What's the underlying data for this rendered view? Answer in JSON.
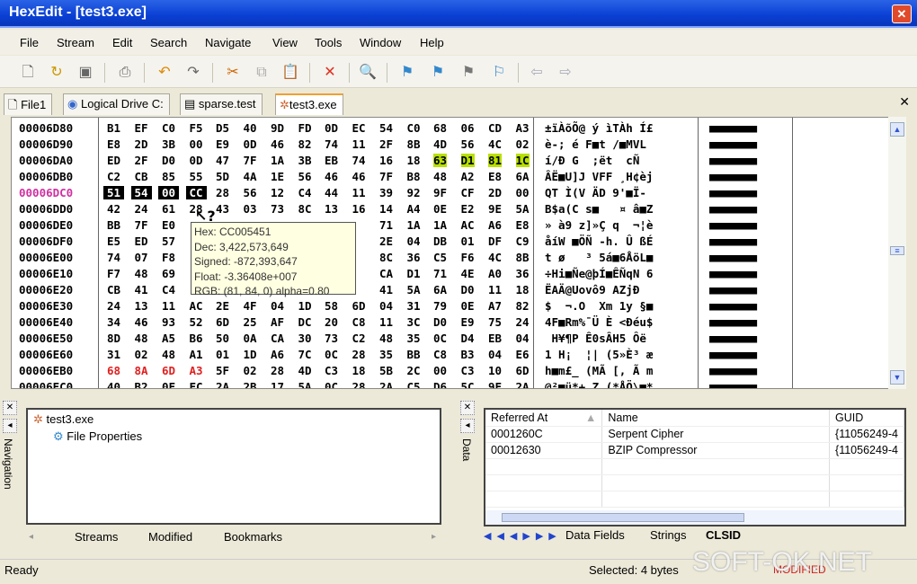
{
  "window": {
    "title": "HexEdit - [test3.exe]",
    "close": "✕"
  },
  "menu": [
    "File",
    "Stream",
    "Edit",
    "Search",
    "Navigate",
    "View",
    "Tools",
    "Window",
    "Help"
  ],
  "toolbar": [
    "new-file",
    "open",
    "save",
    "print",
    "undo",
    "redo",
    "cut",
    "copy",
    "paste",
    "delete",
    "find",
    "bookmark-set",
    "bookmark-next",
    "bookmark-toggle",
    "bookmark-clear",
    "back",
    "forward"
  ],
  "tabs": [
    "File1",
    "Logical Drive C:",
    "sparse.test",
    "test3.exe"
  ],
  "hex": {
    "rows": [
      {
        "addr": "00006D80",
        "bytes": [
          "B1",
          "EF",
          "C0",
          "F5",
          "D5",
          "40",
          "9D",
          "FD",
          "0D",
          "EC",
          "54",
          "C0",
          "68",
          "06",
          "CD",
          "A3"
        ],
        "ascii": "±ïÀõÕ@ ý ìTÀh Í£"
      },
      {
        "addr": "00006D90",
        "bytes": [
          "E8",
          "2D",
          "3B",
          "00",
          "E9",
          "0D",
          "46",
          "82",
          "74",
          "11",
          "2F",
          "8B",
          "4D",
          "56",
          "4C",
          "02"
        ],
        "ascii": "è-; é F■t /■MVL "
      },
      {
        "addr": "00006DA0",
        "bytes": [
          "ED",
          "2F",
          "D0",
          "0D",
          "47",
          "7F",
          "1A",
          "3B",
          "EB",
          "74",
          "16",
          "18",
          "63",
          "D1",
          "81",
          "1C"
        ],
        "ascii": "í/Ð G  ;ët  cÑ  "
      },
      {
        "addr": "00006DB0",
        "bytes": [
          "C2",
          "CB",
          "85",
          "55",
          "5D",
          "4A",
          "1E",
          "56",
          "46",
          "46",
          "7F",
          "B8",
          "48",
          "A2",
          "E8",
          "6A"
        ],
        "ascii": "ÂË■U]J VFF ¸H¢èj"
      },
      {
        "addr": "00006DC0",
        "bytes": [
          "51",
          "54",
          "00",
          "CC",
          "28",
          "56",
          "12",
          "C4",
          "44",
          "11",
          "39",
          "92",
          "9F",
          "CF",
          "2D",
          "00"
        ],
        "ascii": "QT Ì(V ÄD 9'■Ï- "
      },
      {
        "addr": "00006DD0",
        "bytes": [
          "42",
          "24",
          "61",
          "28",
          "43",
          "03",
          "73",
          "8C",
          "13",
          "16",
          "14",
          "A4",
          "0E",
          "E2",
          "9E",
          "5A"
        ],
        "ascii": "B$a(C s■   ¤ â■Z"
      },
      {
        "addr": "00006DE0",
        "bytes": [
          "BB",
          "7F",
          "E0",
          "",
          "",
          "",
          "",
          "",
          "",
          "",
          "71",
          "1A",
          "1A",
          "AC",
          "A6",
          "E8"
        ],
        "ascii": "» à9 z]»Ç q  ¬¦è"
      },
      {
        "addr": "00006DF0",
        "bytes": [
          "E5",
          "ED",
          "57",
          "",
          "",
          "",
          "",
          "",
          "",
          "",
          "2E",
          "04",
          "DB",
          "01",
          "DF",
          "C9"
        ],
        "ascii": "åíW ■ÖÑ -h. Û ßÉ"
      },
      {
        "addr": "00006E00",
        "bytes": [
          "74",
          "07",
          "F8",
          "",
          "",
          "",
          "",
          "",
          "",
          "",
          "8C",
          "36",
          "C5",
          "F6",
          "4C",
          "8B"
        ],
        "ascii": "t ø   ³ 5á■6ÅöL■"
      },
      {
        "addr": "00006E10",
        "bytes": [
          "F7",
          "48",
          "69",
          "",
          "",
          "",
          "",
          "",
          "",
          "",
          "CA",
          "D1",
          "71",
          "4E",
          "A0",
          "36"
        ],
        "ascii": "÷Hi■Ñe@þÍ■ÊÑqN 6"
      },
      {
        "addr": "00006E20",
        "bytes": [
          "CB",
          "41",
          "C4",
          "",
          "",
          "",
          "",
          "",
          "",
          "",
          "41",
          "5A",
          "6A",
          "D0",
          "11",
          "18"
        ],
        "ascii": "ËAÄ@Uovô9 AZjÐ  "
      },
      {
        "addr": "00006E30",
        "bytes": [
          "24",
          "13",
          "11",
          "AC",
          "2E",
          "4F",
          "04",
          "1D",
          "58",
          "6D",
          "04",
          "31",
          "79",
          "0E",
          "A7",
          "82"
        ],
        "ascii": "$  ¬.O  Xm 1y §■"
      },
      {
        "addr": "00006E40",
        "bytes": [
          "34",
          "46",
          "93",
          "52",
          "6D",
          "25",
          "AF",
          "DC",
          "20",
          "C8",
          "11",
          "3C",
          "D0",
          "E9",
          "75",
          "24"
        ],
        "ascii": "4F■Rm%¯Ü È <Ðéu$"
      },
      {
        "addr": "00006E50",
        "bytes": [
          "8D",
          "48",
          "A5",
          "B6",
          "50",
          "0A",
          "CA",
          "30",
          "73",
          "C2",
          "48",
          "35",
          "0C",
          "D4",
          "EB",
          "04"
        ],
        "ascii": " H¥¶P Ê0sÂH5 Ôë "
      },
      {
        "addr": "00006E60",
        "bytes": [
          "31",
          "02",
          "48",
          "A1",
          "01",
          "1D",
          "A6",
          "7C",
          "0C",
          "28",
          "35",
          "BB",
          "C8",
          "B3",
          "04",
          "E6"
        ],
        "ascii": "1 H¡  ¦| (5»È³ æ"
      },
      {
        "addr": "00006EB0",
        "bytes": [
          "68",
          "8A",
          "6D",
          "A3",
          "5F",
          "02",
          "28",
          "4D",
          "C3",
          "18",
          "5B",
          "2C",
          "00",
          "C3",
          "10",
          "6D"
        ],
        "ascii": "h■m£_ (MÃ [, Ã m"
      },
      {
        "addr": "00006EC0",
        "bytes": [
          "40",
          "B2",
          "0F",
          "FC",
          "2A",
          "2B",
          "17",
          "5A",
          "0C",
          "28",
          "2A",
          "C5",
          "D6",
          "5C",
          "9F",
          "2A"
        ],
        "ascii": "@²■ü*+ Z (*ÅÖ\\■*"
      }
    ],
    "selected_row": 4,
    "highlight_row": 2,
    "modified_row": 15,
    "colors": {
      "highlight": "#b8e000",
      "modified": "#e02020",
      "address_mark": "#d030a0"
    }
  },
  "tooltip": {
    "hex": "Hex: CC005451",
    "dec": "Dec: 3,422,573,649",
    "signed": "Signed: -872,393,647",
    "float": "Float: -3.36408e+007",
    "rgb": "RGB: (81, 84, 0) alpha=0.80"
  },
  "navigation": {
    "caption": "Navigation",
    "tree_root": "test3.exe",
    "tree_child": "File Properties",
    "tabs": [
      "Streams",
      "Modified",
      "Bookmarks"
    ]
  },
  "data": {
    "caption": "Data",
    "columns": [
      "Referred At",
      "Name",
      "GUID"
    ],
    "rows": [
      [
        "0001260C",
        "Serpent Cipher",
        "{11056249-4"
      ],
      [
        "00012630",
        "BZIP Compressor",
        "{11056249-4"
      ]
    ],
    "tabs": [
      "Data Fields",
      "Strings",
      "CLSID"
    ]
  },
  "status": {
    "ready": "Ready",
    "selected": "Selected: 4 bytes",
    "modified": "MODIFIED",
    "watermark": "SOFT-OK.NET"
  }
}
